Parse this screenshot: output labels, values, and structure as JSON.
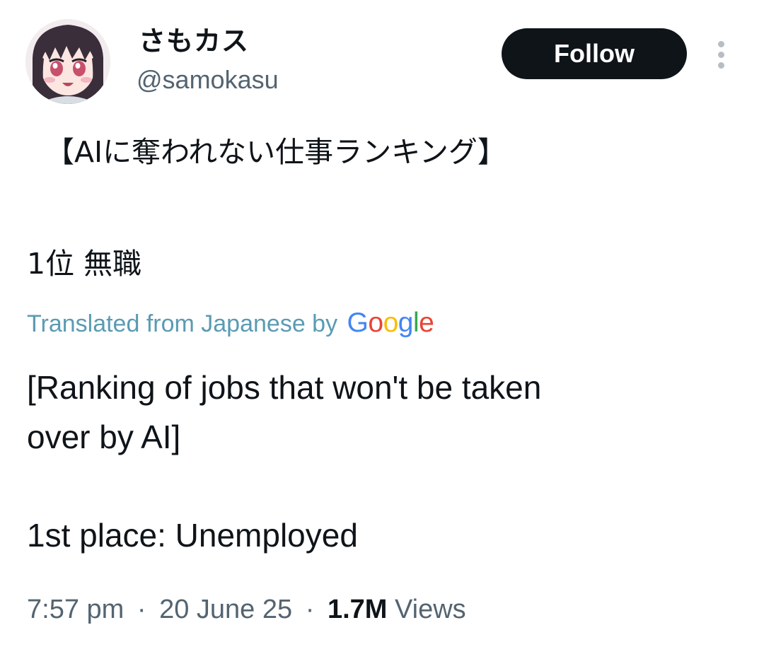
{
  "user": {
    "display_name": "さもカス",
    "handle": "@samokasu",
    "avatar_icon": "anime-girl-avatar"
  },
  "actions": {
    "follow_label": "Follow",
    "more_icon": "vertical-ellipsis-icon"
  },
  "tweet": {
    "original_lines": [
      "【AIに奪われない仕事ランキング】",
      "1位 無職"
    ],
    "translation_note": "Translated from Japanese by",
    "translation_provider": {
      "letters": [
        "G",
        "o",
        "o",
        "g",
        "l",
        "e"
      ],
      "colors": [
        "#4285f4",
        "#ea4335",
        "#fbbc05",
        "#4285f4",
        "#34a853",
        "#ea4335"
      ]
    },
    "translated_lines": [
      "[Ranking of jobs that won't be taken",
      "over by AI]",
      "1st place: Unemployed"
    ]
  },
  "meta": {
    "time": "7:57 pm",
    "date": "20 June 25",
    "separator": "·",
    "views_count": "1.7M",
    "views_label": "Views"
  },
  "colors": {
    "text_primary": "#0f1419",
    "text_secondary": "#536471",
    "translate_link": "#5a9bb3",
    "button_bg": "#0f1419",
    "button_text": "#ffffff"
  }
}
